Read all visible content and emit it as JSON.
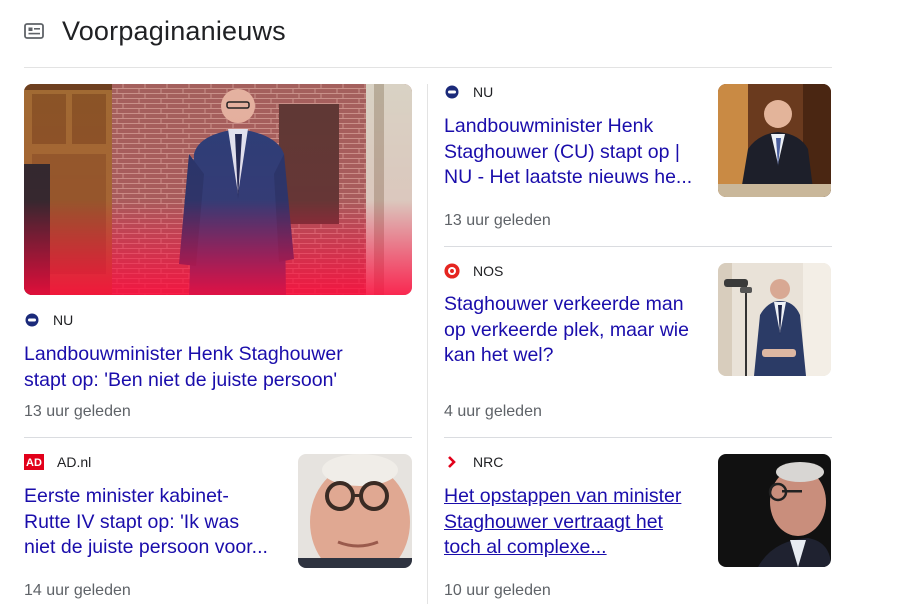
{
  "section": {
    "title": "Voorpaginanieuws",
    "icon": "newspaper-icon"
  },
  "colors": {
    "link": "#1a0dab",
    "meta": "#5f6368",
    "divider": "#dadce0"
  },
  "articles": [
    {
      "source": "NU",
      "source_icon": "nu-logo-icon",
      "headline_lines": [
        "Landbouwminister Henk Staghouwer",
        "stapt op: 'Ben niet de juiste persoon'"
      ],
      "time": "13 uur geleden"
    },
    {
      "source": "NU",
      "source_icon": "nu-logo-icon",
      "headline_lines": [
        "Landbouwminister Henk",
        "Staghouwer (CU) stapt op |",
        "NU - Het laatste nieuws he..."
      ],
      "time": "13 uur geleden"
    },
    {
      "source": "NOS",
      "source_icon": "nos-logo-icon",
      "headline_lines": [
        "Staghouwer verkeerde man",
        "op verkeerde plek, maar wie",
        "kan het wel?"
      ],
      "time": "4 uur geleden"
    },
    {
      "source": "AD.nl",
      "source_icon": "ad-logo-icon",
      "logo_text": "AD",
      "headline_lines": [
        "Eerste minister kabinet-",
        "Rutte IV stapt op: 'Ik was",
        "niet de juiste persoon voor..."
      ],
      "time": "14 uur geleden"
    },
    {
      "source": "NRC",
      "source_icon": "nrc-logo-icon",
      "headline_lines": [
        "Het opstappen van minister",
        "Staghouwer vertraagt het",
        "toch al complexe..."
      ],
      "time": "10 uur geleden"
    }
  ]
}
